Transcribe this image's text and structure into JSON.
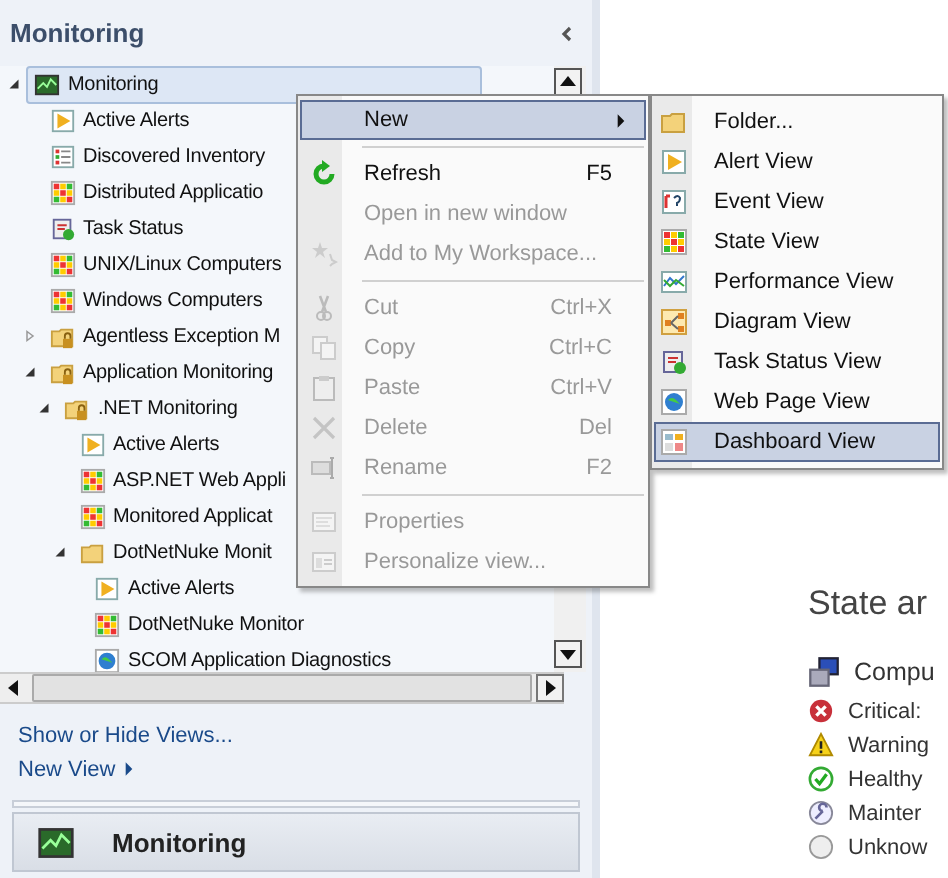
{
  "navigation": {
    "title": "Monitoring",
    "tree": [
      {
        "label": "Monitoring",
        "kind": "monitor",
        "expanded": true,
        "selected": true,
        "children": [
          {
            "label": "Active Alerts",
            "kind": "alert",
            "selected": false
          },
          {
            "label": "Discovered Inventory",
            "kind": "inventory",
            "selected": false
          },
          {
            "label": "Distributed Applicatio",
            "kind": "state",
            "selected": false
          },
          {
            "label": "Task Status",
            "kind": "task",
            "selected": false
          },
          {
            "label": "UNIX/Linux Computers",
            "kind": "state",
            "selected": false
          },
          {
            "label": "Windows Computers",
            "kind": "state",
            "selected": false
          },
          {
            "label": "Agentless Exception M",
            "kind": "lockfolder",
            "expanded": false,
            "selected": false
          },
          {
            "label": "Application Monitoring",
            "kind": "lockfolder",
            "expanded": true,
            "selected": false,
            "children": [
              {
                "label": ".NET Monitoring",
                "kind": "lockfolder",
                "expanded": true,
                "selected": false,
                "children": [
                  {
                    "label": "Active Alerts",
                    "kind": "alert",
                    "selected": false
                  },
                  {
                    "label": "ASP.NET Web Appli",
                    "kind": "state",
                    "selected": false
                  },
                  {
                    "label": "Monitored Applicat",
                    "kind": "state",
                    "selected": false
                  },
                  {
                    "label": "DotNetNuke Monit",
                    "kind": "folder",
                    "expanded": true,
                    "selected": false,
                    "children": [
                      {
                        "label": "Active Alerts",
                        "kind": "alert",
                        "selected": false
                      },
                      {
                        "label": "DotNetNuke Monitor",
                        "kind": "state",
                        "selected": false
                      },
                      {
                        "label": "SCOM Application Diagnostics",
                        "kind": "web",
                        "selected": false
                      }
                    ]
                  }
                ]
              }
            ]
          }
        ]
      }
    ],
    "links": [
      "Show or Hide Views...",
      "New View"
    ],
    "section_button": {
      "label": "Monitoring"
    }
  },
  "context_menu": [
    {
      "label": "New",
      "disabled": false,
      "selected": true,
      "submenu": true
    },
    {
      "label": "Refresh",
      "shortcut": "F5",
      "kind": "refresh",
      "disabled": false,
      "selected": false,
      "separator_before": true
    },
    {
      "label": "Open in new window",
      "disabled": true,
      "selected": false
    },
    {
      "label": "Add to My Workspace...",
      "kind": "add",
      "disabled": true,
      "selected": false
    },
    {
      "label": "Cut",
      "shortcut": "Ctrl+X",
      "kind": "cut",
      "disabled": true,
      "selected": false,
      "separator_before": true
    },
    {
      "label": "Copy",
      "shortcut": "Ctrl+C",
      "kind": "copy",
      "disabled": true,
      "selected": false
    },
    {
      "label": "Paste",
      "shortcut": "Ctrl+V",
      "kind": "paste",
      "disabled": true,
      "selected": false
    },
    {
      "label": "Delete",
      "shortcut": "Del",
      "kind": "delete",
      "disabled": true,
      "selected": false
    },
    {
      "label": "Rename",
      "shortcut": "F2",
      "kind": "rename",
      "disabled": true,
      "selected": false
    },
    {
      "label": "Properties",
      "kind": "properties",
      "disabled": true,
      "selected": false,
      "separator_before": true
    },
    {
      "label": "Personalize view...",
      "kind": "personalize",
      "disabled": true,
      "selected": false
    }
  ],
  "submenu": [
    {
      "label": "Folder...",
      "kind": "folder",
      "selected": false
    },
    {
      "label": "Alert View",
      "kind": "alert",
      "selected": false
    },
    {
      "label": "Event View",
      "kind": "event",
      "selected": false
    },
    {
      "label": "State View",
      "kind": "state",
      "selected": false
    },
    {
      "label": "Performance View",
      "kind": "performance",
      "selected": false
    },
    {
      "label": "Diagram View",
      "kind": "diagram",
      "selected": false
    },
    {
      "label": "Task Status View",
      "kind": "task",
      "selected": false
    },
    {
      "label": "Web Page View",
      "kind": "web",
      "selected": false
    },
    {
      "label": "Dashboard View",
      "kind": "dashboard",
      "selected": true
    }
  ],
  "content": {
    "title": "State ar",
    "legend": [
      {
        "label": "Compu",
        "kind": "computer"
      },
      {
        "label": "Critical:",
        "kind": "critical"
      },
      {
        "label": "Warning",
        "kind": "warning"
      },
      {
        "label": "Healthy",
        "kind": "healthy"
      },
      {
        "label": "Mainter",
        "kind": "maintenance"
      },
      {
        "label": "Unknow",
        "kind": "unknown"
      }
    ]
  }
}
